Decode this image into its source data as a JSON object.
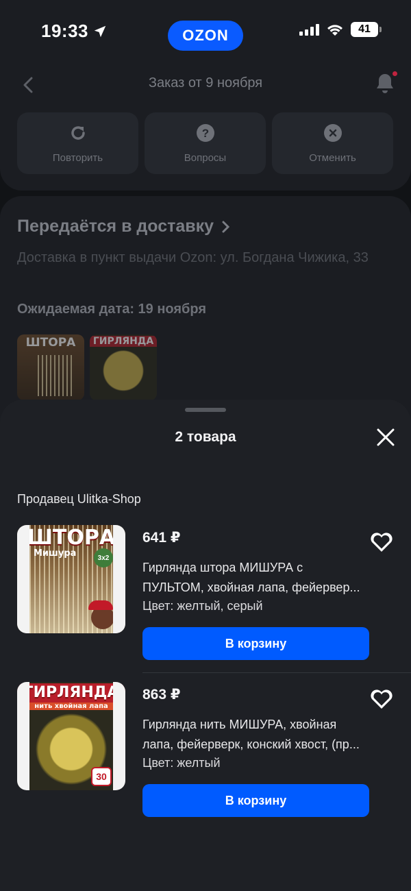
{
  "status_bar": {
    "time": "19:33",
    "brand": "OZON",
    "battery": "41"
  },
  "header": {
    "title": "Заказ от 9 ноября",
    "actions": [
      {
        "label": "Повторить",
        "icon": "repeat-icon"
      },
      {
        "label": "Вопросы",
        "icon": "question-icon"
      },
      {
        "label": "Отменить",
        "icon": "cancel-icon"
      }
    ]
  },
  "delivery": {
    "title": "Передаётся в доставку",
    "address": "Доставка в пункт выдачи Ozon: ул. Богдана Чижика, 33",
    "expected_date": "Ожидаемая дата: 19 ноября",
    "thumbs": [
      {
        "caption": "ШТОРА"
      },
      {
        "caption": "ГИРЛЯНДА"
      }
    ]
  },
  "sheet": {
    "title": "2 товара",
    "seller": "Продавец Ulitka-Shop",
    "items": [
      {
        "price": "641 ₽",
        "name_line1": "Гирлянда штора МИШУРА с",
        "name_line2": "ПУЛЬТОМ, хвойная лапа, фейервер...",
        "color": "Цвет: желтый, серый",
        "button": "В корзину",
        "image_title": "ШТОРА",
        "image_subtitle": "Мишура",
        "image_badge": "3x2"
      },
      {
        "price": "863 ₽",
        "name_line1": "Гирлянда нить МИШУРА, хвойная",
        "name_line2": "лапа, фейерверк, конский хвост, (пр...",
        "color": "Цвет: желтый",
        "button": "В корзину",
        "image_title": "ГИРЛЯНДА",
        "image_subtitle": "нить хвойная лапа",
        "image_badge": "30"
      }
    ]
  },
  "colors": {
    "accent": "#005bff",
    "sheet_bg": "#1e2025",
    "background": "#111316"
  }
}
